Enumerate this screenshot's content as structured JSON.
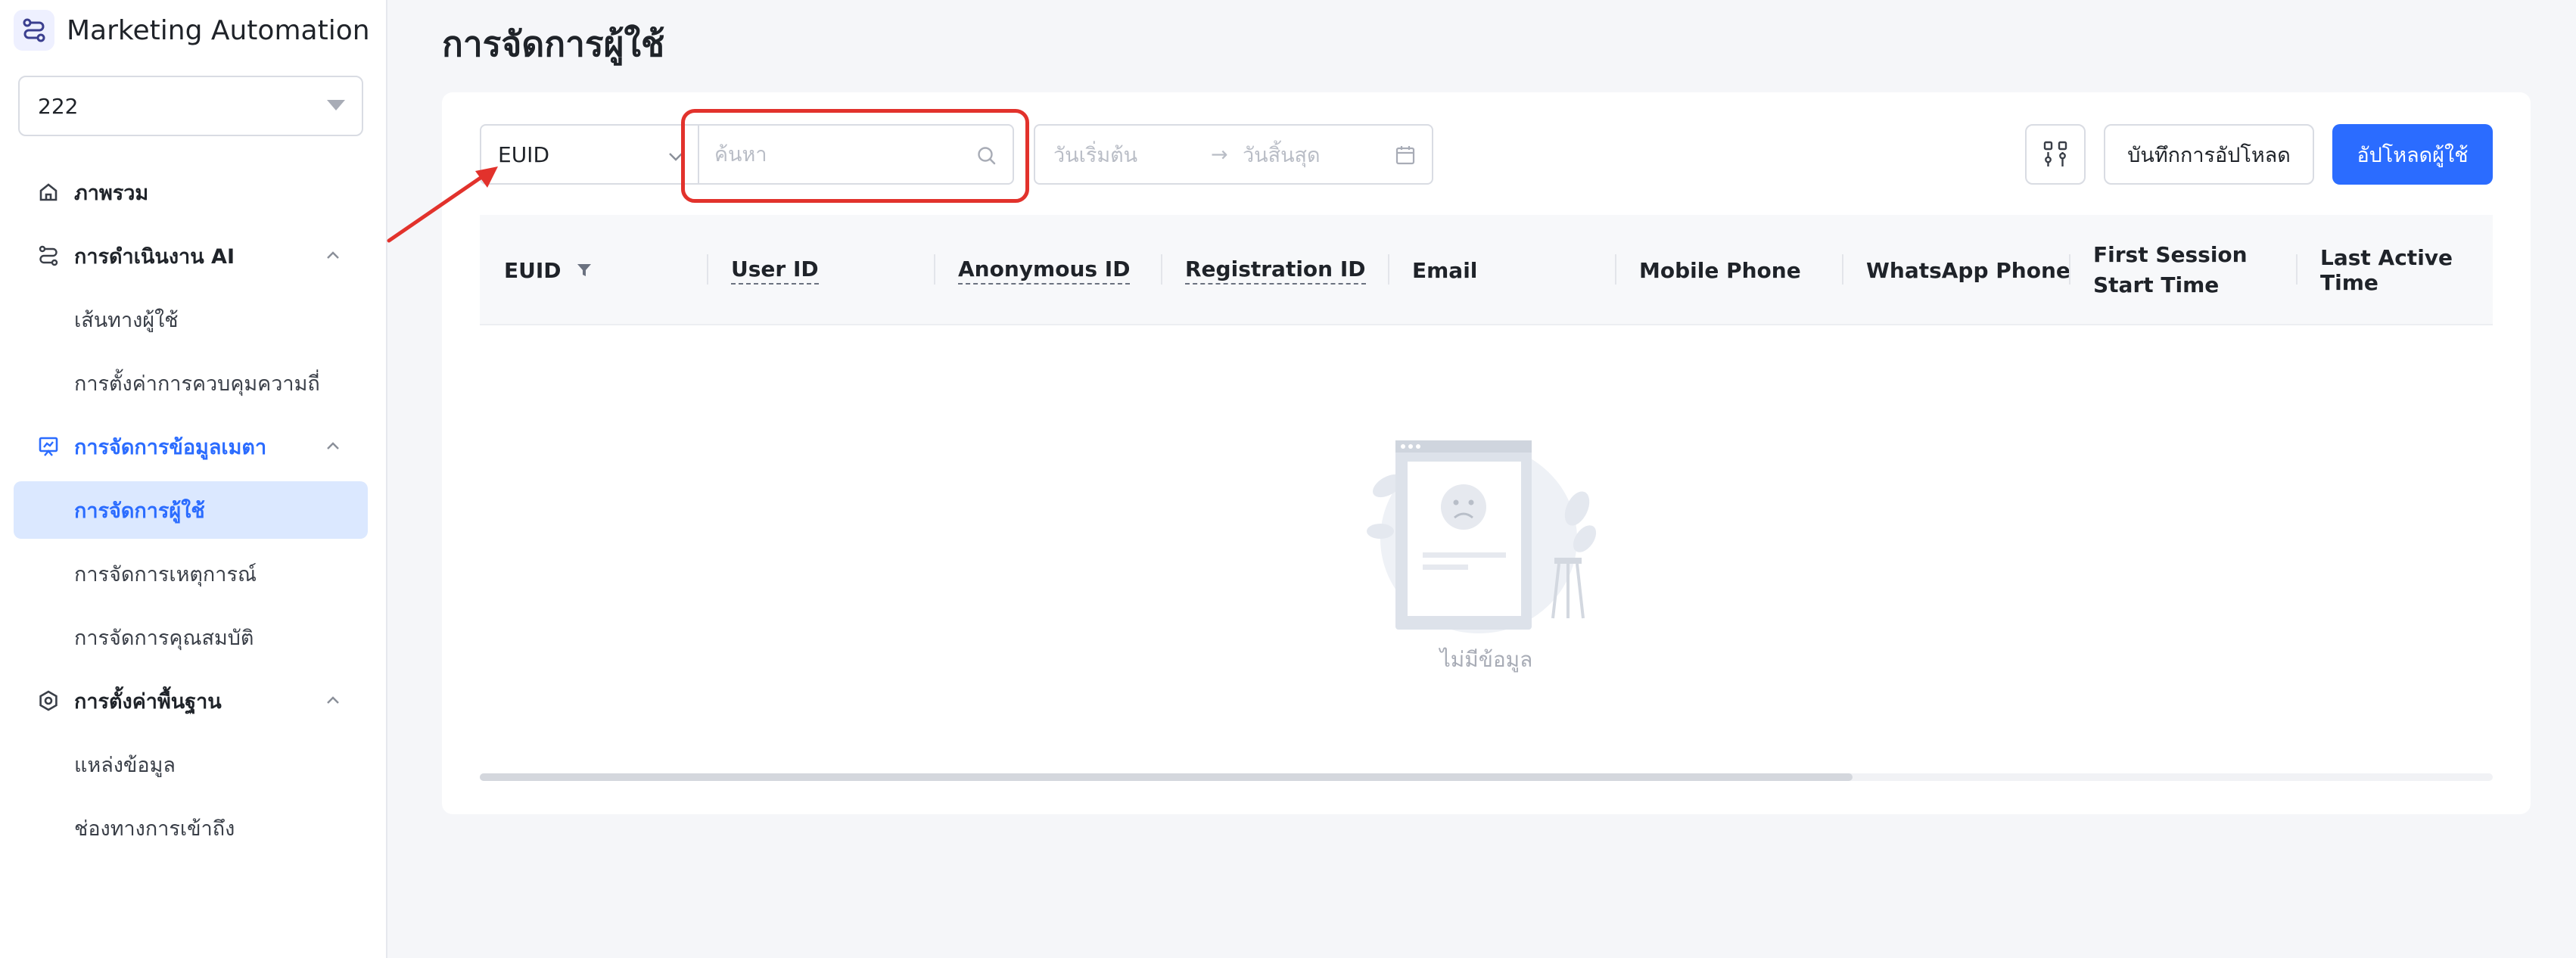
{
  "app": {
    "name": "Marketing Automation",
    "project": "222"
  },
  "sidebar": {
    "items": [
      {
        "label": "ภาพรวม"
      },
      {
        "label": "การดำเนินงาน AI"
      },
      {
        "label": "เส้นทางผู้ใช้"
      },
      {
        "label": "การตั้งค่าการควบคุมความถี่"
      },
      {
        "label": "การจัดการข้อมูลเมตา"
      },
      {
        "label": "การจัดการผู้ใช้"
      },
      {
        "label": "การจัดการเหตุการณ์"
      },
      {
        "label": "การจัดการคุณสมบัติ"
      },
      {
        "label": "การตั้งค่าพื้นฐาน"
      },
      {
        "label": "แหล่งข้อมูล"
      },
      {
        "label": "ช่องทางการเข้าถึง"
      }
    ]
  },
  "main": {
    "title": "การจัดการผู้ใช้",
    "toolbar": {
      "field_select": "EUID",
      "search_placeholder": "ค้นหา",
      "date_start_placeholder": "วันเริ่มต้น",
      "date_arrow": "→",
      "date_end_placeholder": "วันสิ้นสุด",
      "upload_log_label": "บันทึกการอัปโหลด",
      "upload_users_label": "อัปโหลดผู้ใช้"
    },
    "table": {
      "columns": [
        "EUID",
        "User ID",
        "Anonymous ID",
        "Registration ID",
        "Email",
        "Mobile Phone",
        "WhatsApp Phone",
        "First Session Start Time",
        "Last Active Time"
      ],
      "empty_text": "ไม่มีข้อมูล"
    }
  },
  "colors": {
    "primary": "#2b6cff",
    "highlight": "#e2322c",
    "selected_bg": "#dbe8ff"
  },
  "icons": {
    "brand": "flow-icon",
    "overview": "home-icon",
    "ai_ops": "flow-icon",
    "metadata": "presentation-icon",
    "settings": "hexagon-gear-icon"
  }
}
